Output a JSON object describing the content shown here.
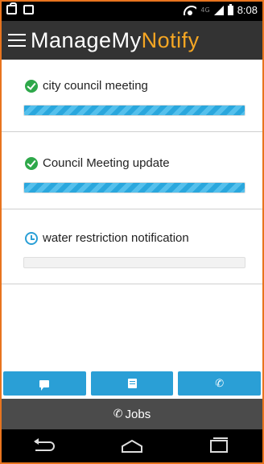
{
  "status_bar": {
    "time": "8:08",
    "network_label": "4G",
    "icons": [
      "bag-icon",
      "image-icon",
      "wifi-icon",
      "signal-icon",
      "battery-icon"
    ]
  },
  "app_bar": {
    "title_part1": "ManageMy",
    "title_part2": "Notify",
    "title_colors": {
      "part1": "#ffffff",
      "part2": "#f5a623"
    },
    "background": "#333333"
  },
  "jobs": [
    {
      "title": "city council meeting",
      "status": "complete",
      "status_icon": "check-circle-icon",
      "progress": 1.0
    },
    {
      "title": "Council Meeting update",
      "status": "complete",
      "status_icon": "check-circle-icon",
      "progress": 1.0
    },
    {
      "title": "water restriction notification",
      "status": "pending",
      "status_icon": "clock-icon",
      "progress": 0.0
    }
  ],
  "action_buttons": [
    {
      "name": "message-button",
      "icon": "chat-icon"
    },
    {
      "name": "list-button",
      "icon": "list-icon"
    },
    {
      "name": "call-button",
      "icon": "phone-icon"
    }
  ],
  "bottom_tab": {
    "label": "Jobs",
    "icon": "phone-icon"
  },
  "nav_bar": {
    "buttons": [
      "back-icon",
      "home-icon",
      "recents-icon"
    ]
  },
  "colors": {
    "accent": "#2a9fd6",
    "success": "#2ea84a",
    "frame": "#e8741e"
  }
}
